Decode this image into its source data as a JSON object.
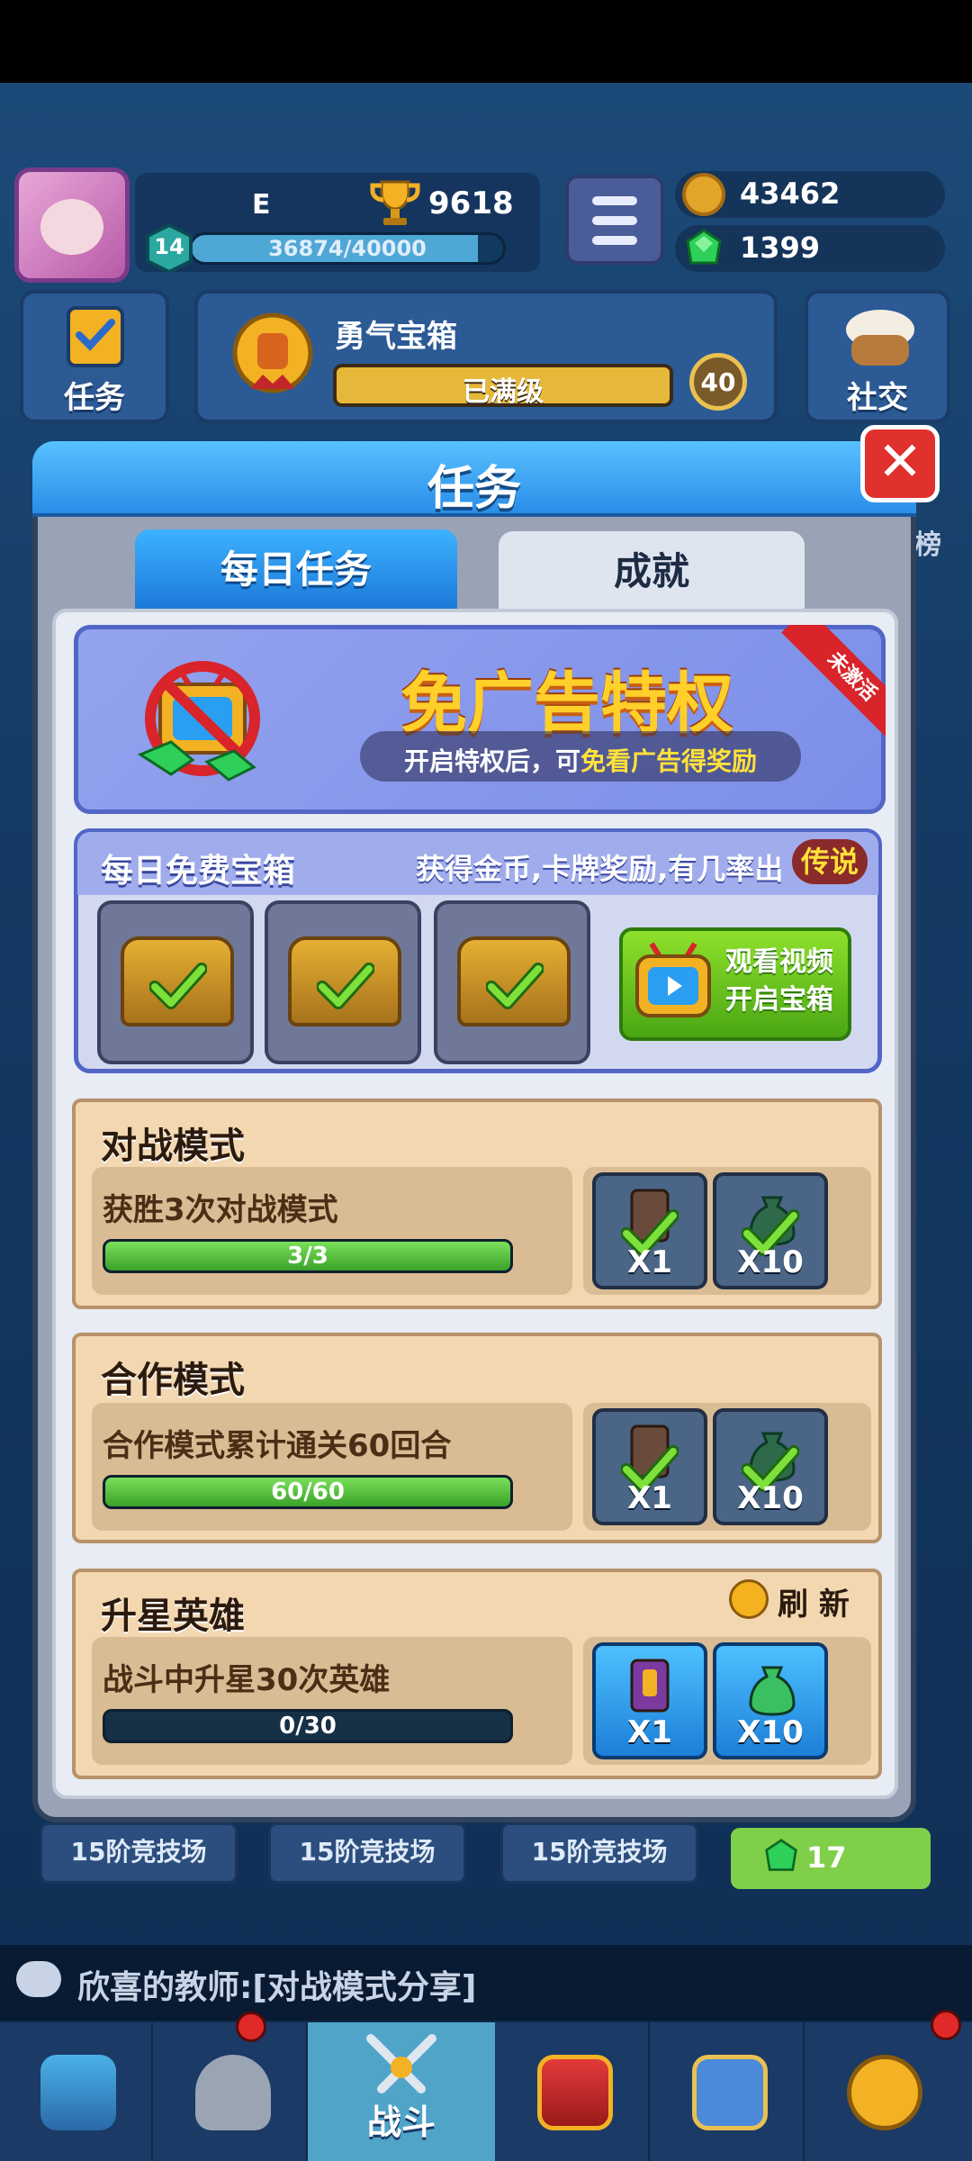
{
  "hud": {
    "player_name": "E",
    "trophies": "9618",
    "level": "14",
    "xp_text": "36874/40000",
    "xp_fraction": 0.92,
    "gold": "43462",
    "gems": "1399",
    "task_button": "任务",
    "chest_name": "勇气宝箱",
    "chest_status": "已满级",
    "chest_level": "40",
    "social_button": "社交"
  },
  "modal": {
    "title": "任务",
    "close_symbol": "✕",
    "tabs": [
      {
        "label": "每日任务",
        "active": true
      },
      {
        "label": "成就",
        "active": false
      }
    ],
    "ad_privilege": {
      "title": "免广告特权",
      "subtitle_prefix": "开启特权后，可",
      "subtitle_highlight": "免看广告得奖励",
      "ribbon": "未激活"
    },
    "free_chest": {
      "title": "每日免费宝箱",
      "description": "获得金币,卡牌奖励,有几率出",
      "legend_tag": "传说",
      "slots_claimed": 3,
      "watch_button_line1": "观看视频",
      "watch_button_line2": "开启宝箱"
    },
    "tasks": [
      {
        "title": "对战模式",
        "description": "获胜3次对战模式",
        "progress_text": "3/3",
        "progress": 1.0,
        "rewards": [
          {
            "label": "X1",
            "icon": "card-icon",
            "claimed": true
          },
          {
            "label": "X10",
            "icon": "money-bag-icon",
            "claimed": true
          }
        ]
      },
      {
        "title": "合作模式",
        "description": "合作模式累计通关60回合",
        "progress_text": "60/60",
        "progress": 1.0,
        "rewards": [
          {
            "label": "X1",
            "icon": "card-icon",
            "claimed": true
          },
          {
            "label": "X10",
            "icon": "money-bag-icon",
            "claimed": true
          }
        ]
      },
      {
        "title": "升星英雄",
        "description": "战斗中升星30次英雄",
        "progress_text": "0/30",
        "progress": 0.0,
        "refresh_label": "刷 新",
        "rewards": [
          {
            "label": "X1",
            "icon": "card-icon",
            "claimed": false
          },
          {
            "label": "X10",
            "icon": "money-bag-icon",
            "claimed": false
          }
        ]
      }
    ]
  },
  "background": {
    "arena_labels": [
      "15阶竞技场",
      "15阶竞技场",
      "15阶竞技场"
    ],
    "gem_count": "17",
    "side_label": "榜"
  },
  "chat": {
    "message": "欣喜的教师:[对战模式分享]"
  },
  "nav": {
    "battle_label": "战斗",
    "items": [
      "shop-chest-icon",
      "knight-helmet-icon",
      "battle-swords-icon",
      "crown-laurel-icon",
      "team-icon",
      "compass-icon"
    ]
  },
  "colors": {
    "accent_blue": "#2a8ee8",
    "close_red": "#e0312e",
    "progress_green": "#3aa22a",
    "gold_text": "#ffcf2a"
  }
}
